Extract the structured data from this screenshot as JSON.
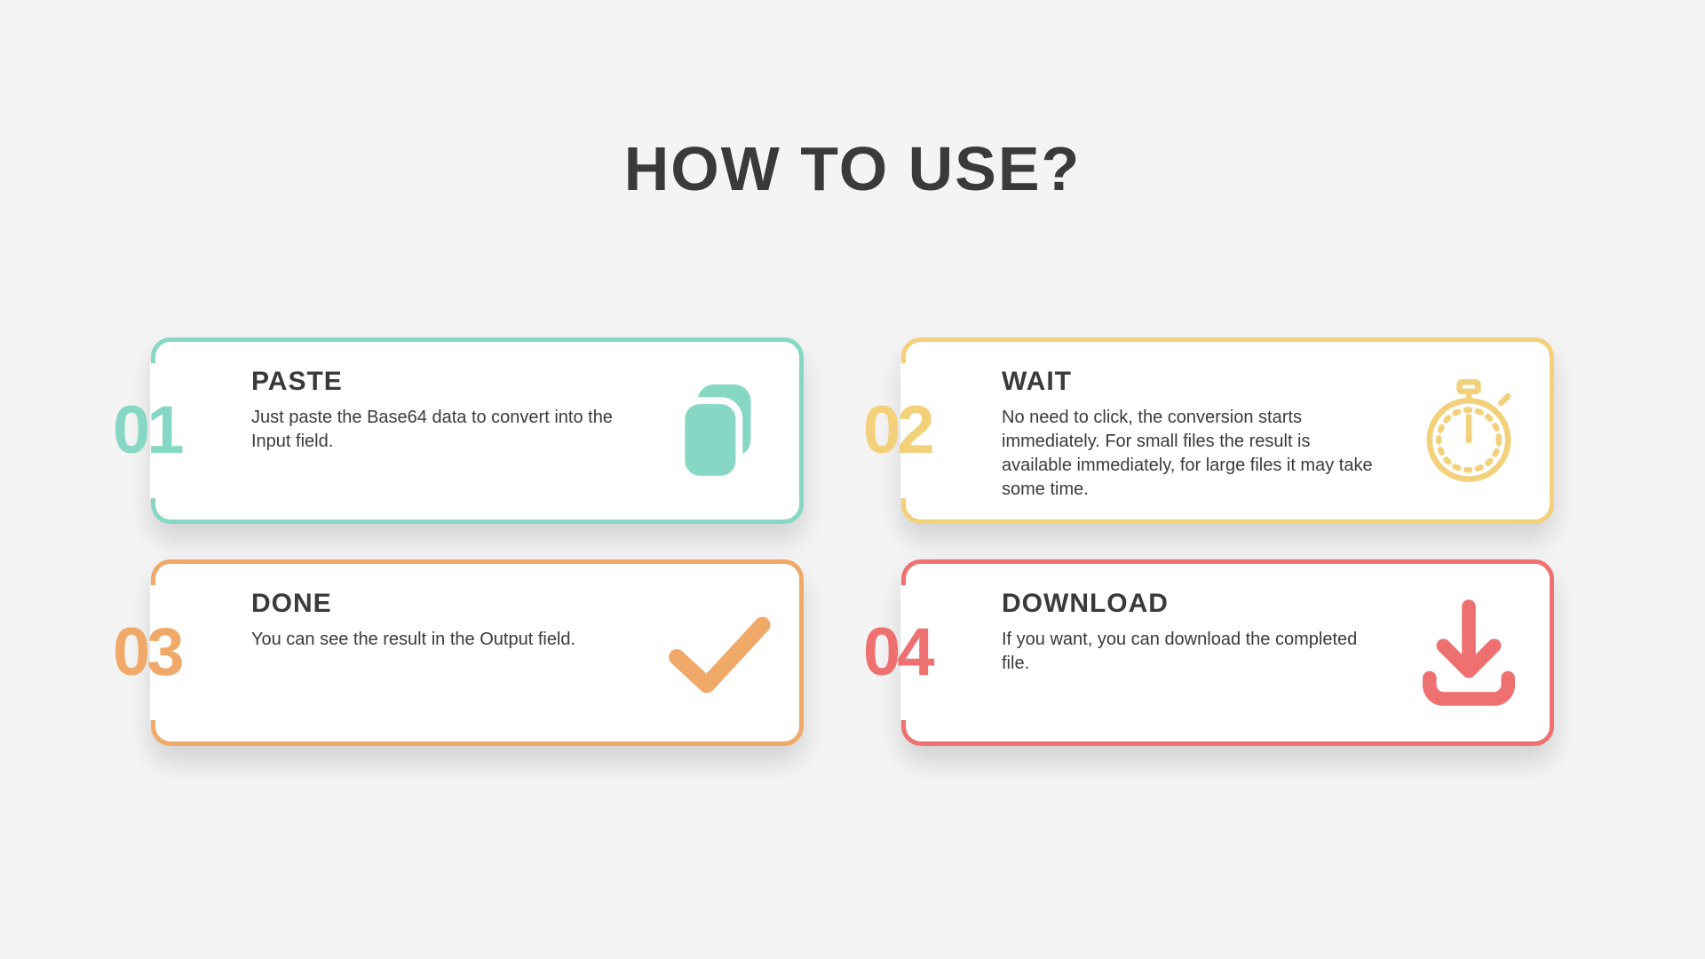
{
  "title": "HOW TO USE?",
  "steps": [
    {
      "num": "01",
      "title": "PASTE",
      "desc": "Just paste the Base64 data to convert into the Input field.",
      "color": "#86d8c4",
      "icon": "clipboard-icon"
    },
    {
      "num": "02",
      "title": "WAIT",
      "desc": "No need to click, the conversion starts immediately. For small files the result is available immediately, for large files it may take some time.",
      "color": "#f3d07a",
      "icon": "stopwatch-icon"
    },
    {
      "num": "03",
      "title": "DONE",
      "desc": "You can see the result in the Output field.",
      "color": "#f0a968",
      "icon": "check-icon"
    },
    {
      "num": "04",
      "title": "DOWNLOAD",
      "desc": "If you want, you can download the completed file.",
      "color": "#ef7070",
      "icon": "download-icon"
    }
  ]
}
